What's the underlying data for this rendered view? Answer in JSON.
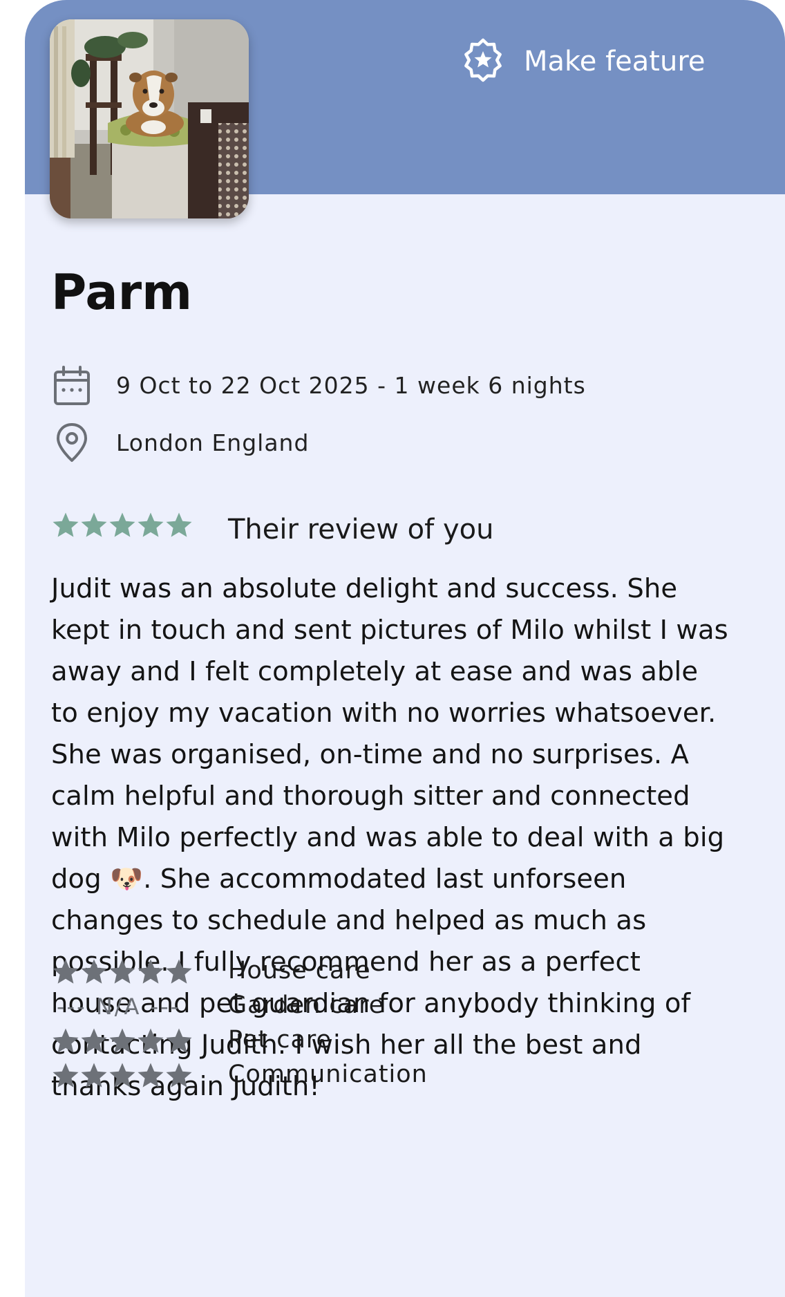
{
  "header": {
    "feature_label": "Make feature",
    "banner_color": "#7590c3",
    "card_color": "#edf0fc"
  },
  "listing": {
    "photo_icon": "pet-photo",
    "name": "Parm",
    "dates": "9 Oct to 22 Oct 2025 - 1 week 6 nights",
    "location": "London England"
  },
  "review": {
    "stars": 5,
    "star_color": "#7ba898",
    "title": "Their review of you",
    "lines": [
      "Judit was an absolute delight and success. She",
      "kept in touch and sent pictures of Milo whilst I was",
      "away and I felt completely at ease and was able",
      "to enjoy my vacation with no worries whatsoever.",
      "She was organised, on-time and no surprises. A",
      "calm helpful and thorough sitter and connected",
      "with Milo perfectly and was able to deal with a big",
      "dog 🐶. She accommodated last unforseen",
      "changes to schedule and helped as much as",
      "possible. I fully recommend her as a perfect",
      "house and pet guardian for anybody thinking of",
      "contacting Judith. I wish her all the best and",
      "thanks again Judith!"
    ]
  },
  "ratings": {
    "star_color": "#6d7178",
    "items": [
      {
        "label": "House care",
        "stars": 5
      },
      {
        "label": "Garden care",
        "na_text": "--- N/A ---"
      },
      {
        "label": "Pet care",
        "stars": 5
      },
      {
        "label": "Communication",
        "stars": 5
      }
    ]
  }
}
